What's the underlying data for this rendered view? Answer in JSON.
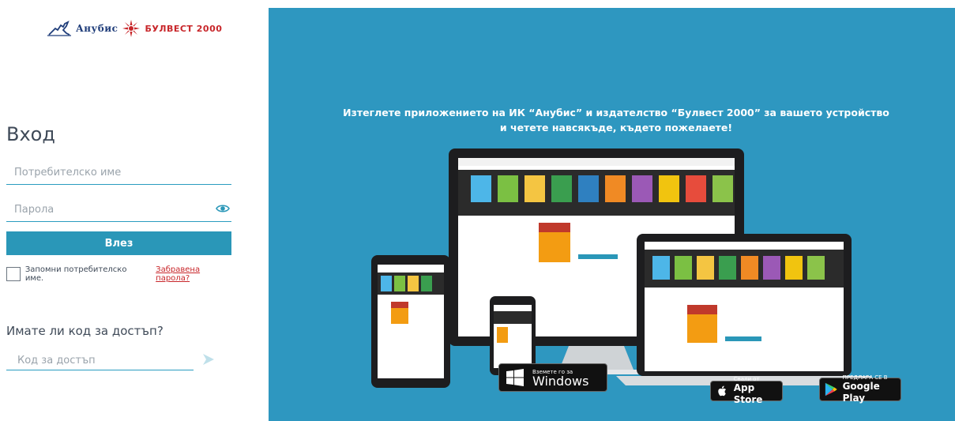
{
  "brand": {
    "anubis": "Анубис",
    "bulvest": "БУЛВЕСТ 2000"
  },
  "login": {
    "title": "Вход",
    "username_placeholder": "Потребителско име",
    "password_placeholder": "Парола",
    "submit_label": "Влез",
    "remember_label": "Запомни потребителско име.",
    "forgot_label": "Забравена парола?",
    "code_title": "Имате ли код за достъп?",
    "code_placeholder": "Код за достъп"
  },
  "promo": {
    "line1": "Изтеглете приложението на ИК “Анубис” и издателство “Булвест 2000” за вашето устройство",
    "line2": "и четете навсякъде, където пожелаете!"
  },
  "stores": {
    "windows_small": "Вземете го за",
    "windows_big": "Windows",
    "appstore_small": "Свали от",
    "appstore_big": "App Store",
    "googleplay_small": "ПРЕДЛАГА СЕ В",
    "googleplay_big": "Google Play"
  },
  "colors": {
    "accent": "#2a97b8",
    "promo_bg": "#2e97c0",
    "link_red": "#c8262a"
  }
}
